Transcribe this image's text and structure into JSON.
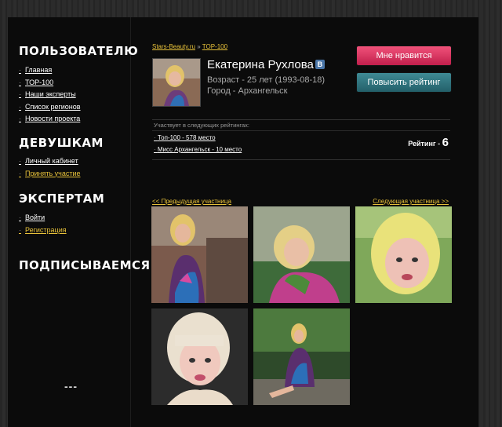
{
  "sidebar": {
    "sections": [
      {
        "title": "ПОЛЬЗОВАТЕЛЮ",
        "items": [
          "Главная",
          "ТОР-100",
          "Наши эксперты",
          "Список регионов",
          "Новости проекта"
        ]
      },
      {
        "title": "ДЕВУШКАМ",
        "items": [
          "Личный кабинет",
          "Принять участие"
        ]
      },
      {
        "title": "ЭКСПЕРТАМ",
        "items": [
          "Войти",
          "Регистрация"
        ]
      },
      {
        "title": "ПОДПИСЫВАЕМСЯ!",
        "items": []
      }
    ],
    "footer_dots": "---"
  },
  "breadcrumb": {
    "home": "Stars-Beauty.ru",
    "sep": "»",
    "current": "TOP-100"
  },
  "profile": {
    "name": "Екатерина Рухлова",
    "vk_badge": "В",
    "age_line": "Возраст - 25 лет (1993-08-18)",
    "city_line": "Город - Архангельск"
  },
  "buttons": {
    "like": "Мне нравится",
    "boost": "Повысить рейтинг"
  },
  "rankings": {
    "heading": "Участвует в следующих рейтингах:",
    "items": [
      "Топ-100 - 578 место",
      "Мисс Архангельск - 10 место"
    ],
    "rating_label": "Рейтинг -",
    "rating_value": "6"
  },
  "navigation": {
    "prev": "<< Предыдущая участница",
    "next": "Следующая участница >>"
  },
  "colors": {
    "accent": "#e8c23a",
    "like": "#d92e5a",
    "boost": "#2f7580"
  }
}
